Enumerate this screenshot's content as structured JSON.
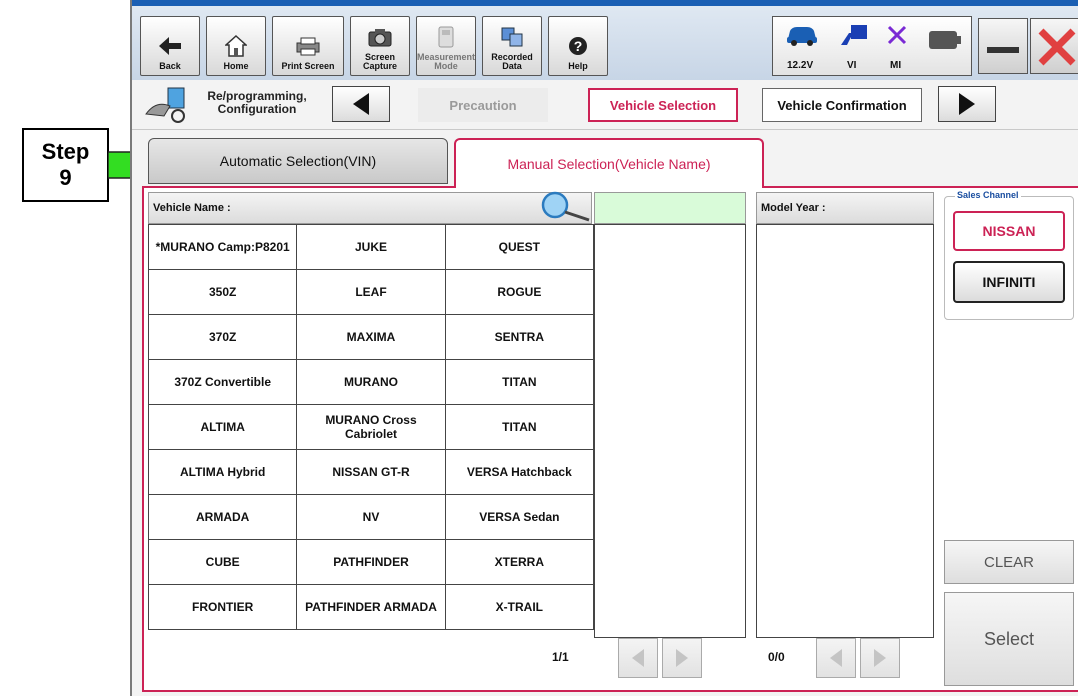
{
  "callout": {
    "step_word": "Step",
    "step_number": "9"
  },
  "toolbar": {
    "back": "Back",
    "home": "Home",
    "print_screen": "Print Screen",
    "screen_capture_1": "Screen",
    "screen_capture_2": "Capture",
    "measurement_1": "Measurement",
    "measurement_2": "Mode",
    "recorded_1": "Recorded",
    "recorded_2": "Data",
    "help": "Help",
    "voltage": "12.2V",
    "vi": "VI",
    "mi": "MI"
  },
  "navbar": {
    "reprog_1": "Re/programming,",
    "reprog_2": "Configuration",
    "crumbs": [
      "Precaution",
      "Vehicle Selection",
      "Vehicle Confirmation"
    ]
  },
  "tabs": {
    "automatic": "Automatic Selection(VIN)",
    "manual": "Manual Selection(Vehicle Name)"
  },
  "vehicle_list": {
    "header": "Vehicle Name :",
    "rows": [
      [
        "*MURANO Camp:P8201",
        "JUKE",
        "QUEST"
      ],
      [
        "350Z",
        "LEAF",
        "ROGUE"
      ],
      [
        "370Z",
        "MAXIMA",
        "SENTRA"
      ],
      [
        "370Z Convertible",
        "MURANO",
        "TITAN"
      ],
      [
        "ALTIMA",
        "MURANO Cross Cabriolet",
        "TITAN"
      ],
      [
        "ALTIMA Hybrid",
        "NISSAN GT-R",
        "VERSA Hatchback"
      ],
      [
        "ARMADA",
        "NV",
        "VERSA Sedan"
      ],
      [
        "CUBE",
        "PATHFINDER",
        "XTERRA"
      ],
      [
        "FRONTIER",
        "PATHFINDER ARMADA",
        "X-TRAIL"
      ]
    ],
    "page": "1/1"
  },
  "model_year": {
    "header": "Model Year :",
    "page": "0/0"
  },
  "sales_channel": {
    "legend": "Sales Channel",
    "nissan": "NISSAN",
    "infiniti": "INFINITI"
  },
  "actions": {
    "clear": "CLEAR",
    "select": "Select"
  },
  "colors": {
    "accent": "#cc2255",
    "callout_arrow": "#33dd22",
    "green_header": "#d9fbd9"
  }
}
